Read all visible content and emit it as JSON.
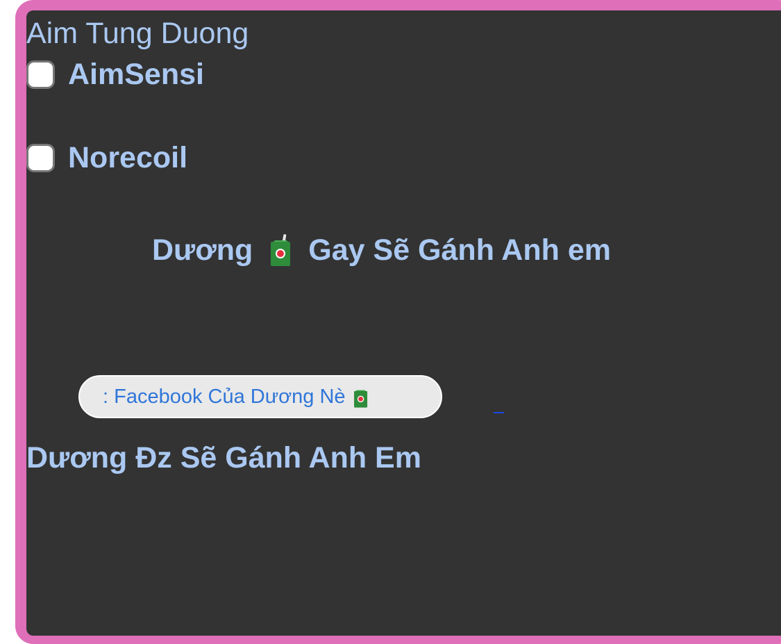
{
  "app": {
    "title": "Aim Tung Duong"
  },
  "options": [
    {
      "label": "AimSensi",
      "checked": false
    },
    {
      "label": "Norecoil",
      "checked": false
    }
  ],
  "headline": {
    "left_text": "Dương",
    "icon": "juice-box-icon",
    "right_text": "Gay Sẽ Gánh Anh em"
  },
  "facebook_button": {
    "label": ": Facebook Của Dương Nè",
    "icon": "juice-box-icon"
  },
  "footer": {
    "text": "Dương Đz Sẽ Gánh Anh Em"
  },
  "colors": {
    "outer_frame": "#de6fb8",
    "panel": "#333333",
    "text": "#aac8f1",
    "button_background": "#e9e9e9",
    "button_text": "#2f76d9",
    "link": "#1a49e8"
  }
}
